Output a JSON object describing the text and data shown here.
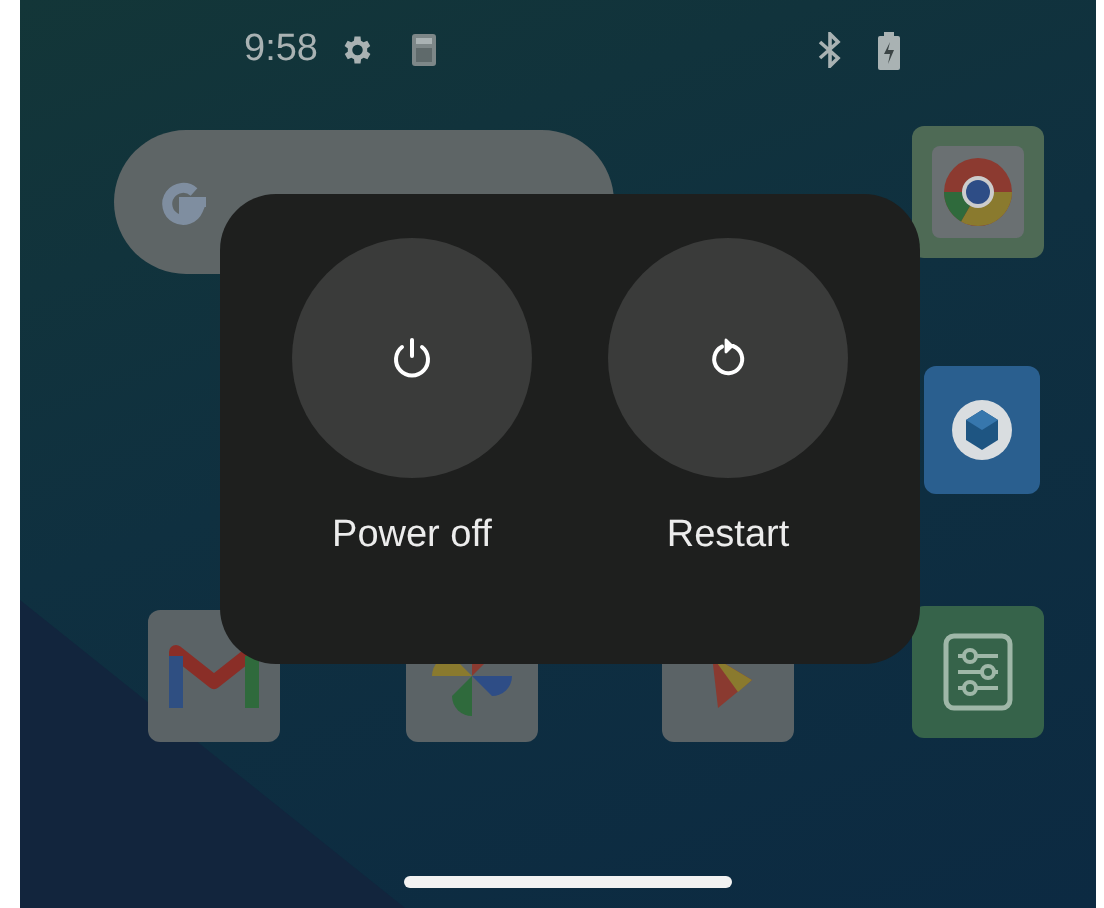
{
  "status_bar": {
    "time": "9:58"
  },
  "power_menu": {
    "options": [
      {
        "kind": "power",
        "label": "Power off"
      },
      {
        "kind": "restart",
        "label": "Restart"
      }
    ]
  }
}
